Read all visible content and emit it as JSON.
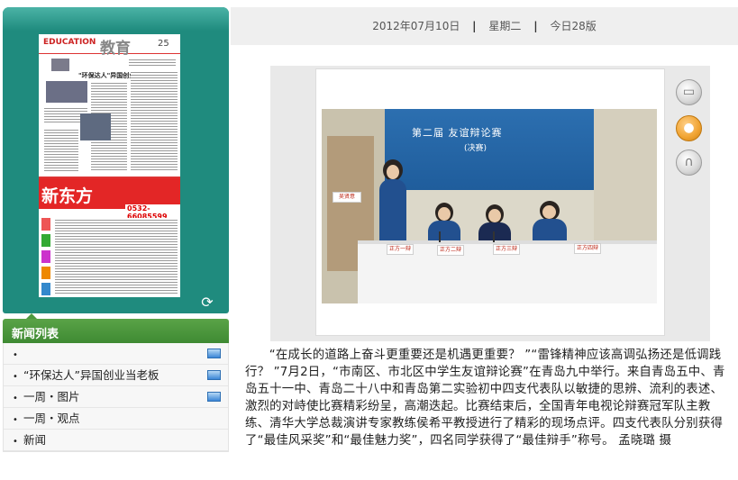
{
  "newspaper": {
    "logo_text": "EDUCATION",
    "section_title": "教育",
    "page_number": "25",
    "headline": "\"环保达人\"异国创业当老板",
    "ad_brand": "新东方",
    "ad_phone": "0532-66085599"
  },
  "rotate_icon": "refresh-icon",
  "news": {
    "title": "新闻列表",
    "items": [
      {
        "label": "",
        "has_thumbnail": true
      },
      {
        "label": "“环保达人”异国创业当老板",
        "has_thumbnail": true
      },
      {
        "label": "一周・图片",
        "has_thumbnail": true
      },
      {
        "label": "一周・观点",
        "has_thumbnail": false
      },
      {
        "label": "新闻",
        "has_thumbnail": false
      }
    ]
  },
  "date_bar": {
    "date": "2012年07月10日",
    "weekday": "星期二",
    "edition": "今日28版"
  },
  "photo": {
    "banner_line1": "第二届 友谊辩论赛",
    "banner_line2": "(决赛)",
    "nameplates": [
      "正方一辩",
      "正方二辩",
      "正方三辩",
      "正方四辩"
    ],
    "side_left_plate": "吴贤意",
    "side_right_plate": "正方四辩"
  },
  "side_icons": [
    "video-icon",
    "person-icon",
    "headphones-icon"
  ],
  "article": {
    "text": "“在成长的道路上奋斗更重要还是机遇更重要？ ”“雷锋精神应该高调弘扬还是低调践行？ ”7月2日，“市南区、市北区中学生友谊辩论赛”在青岛九中举行。来自青岛五中、青岛五十一中、青岛二十八中和青岛第二实验初中四支代表队以敏捷的思辨、流利的表述、激烈的对峙使比赛精彩纷呈，高潮迭起。比赛结束后，全国青年电视论辩赛冠军队主教练、清华大学总裁演讲专家教练侯希平教授进行了精彩的现场点评。四支代表队分别获得了“最佳风采奖”和“最佳魅力奖”，四名同学获得了“最佳辩手”称号。 孟晓璐 摄"
  },
  "colors": {
    "paper_panel": "#1f8b7e",
    "news_header": "#4d9a3e",
    "active_icon": "#f0a331"
  }
}
